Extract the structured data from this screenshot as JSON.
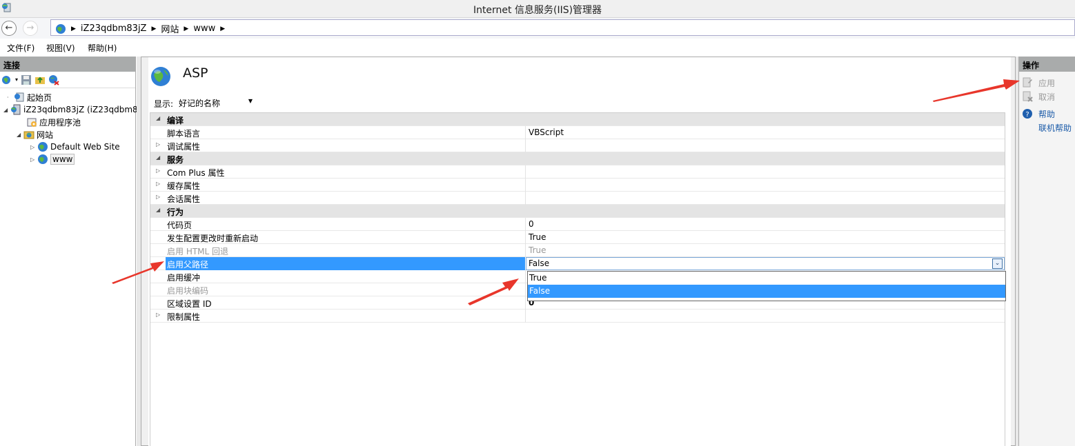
{
  "window": {
    "title": "Internet 信息服务(IIS)管理器"
  },
  "address": {
    "crumbs": [
      "iZ23qdbm83jZ",
      "网站",
      "www"
    ]
  },
  "menu": {
    "file": "文件(F)",
    "view": "视图(V)",
    "help": "帮助(H)"
  },
  "connections": {
    "header": "连接",
    "tree": [
      {
        "label": "起始页",
        "icon": "start-page-icon"
      },
      {
        "label": "iZ23qdbm83jZ (iZ23qdbm8",
        "icon": "server-icon"
      },
      {
        "label": "应用程序池",
        "icon": "app-pool-icon"
      },
      {
        "label": "网站",
        "icon": "sites-folder-icon"
      },
      {
        "label": "Default Web Site",
        "icon": "globe-icon"
      },
      {
        "label": "www",
        "icon": "globe-icon"
      }
    ]
  },
  "main": {
    "title": "ASP",
    "show_label": "显示:",
    "show_value": "好记的名称",
    "rows": [
      {
        "kind": "cat",
        "name": "编译",
        "toggle": "◢"
      },
      {
        "kind": "prop",
        "name": "脚本语言",
        "value": "VBScript"
      },
      {
        "kind": "group",
        "name": "调试属性",
        "toggle": "▷"
      },
      {
        "kind": "cat",
        "name": "服务",
        "toggle": "◢"
      },
      {
        "kind": "group",
        "name": "Com Plus 属性",
        "toggle": "▷"
      },
      {
        "kind": "group",
        "name": "缓存属性",
        "toggle": "▷"
      },
      {
        "kind": "group",
        "name": "会话属性",
        "toggle": "▷"
      },
      {
        "kind": "cat",
        "name": "行为",
        "toggle": "◢"
      },
      {
        "kind": "prop",
        "name": "代码页",
        "value": "0"
      },
      {
        "kind": "prop",
        "name": "发生配置更改时重新启动",
        "value": "True"
      },
      {
        "kind": "disabled",
        "name": "启用 HTML 回退",
        "value": "True"
      },
      {
        "kind": "selected",
        "name": "启用父路径",
        "value": "False"
      },
      {
        "kind": "prop",
        "name": "启用缓冲",
        "value": ""
      },
      {
        "kind": "disabled",
        "name": "启用块编码",
        "value": ""
      },
      {
        "kind": "prop",
        "name": "区域设置 ID",
        "value": "0"
      },
      {
        "kind": "group",
        "name": "限制属性",
        "toggle": "▷"
      }
    ],
    "dropdown_options": [
      "True",
      "False"
    ],
    "dropdown_selected": "False"
  },
  "actions": {
    "header": "操作",
    "apply": "应用",
    "cancel": "取消",
    "help": "帮助",
    "online_help": "联机帮助"
  },
  "colors": {
    "selection": "#3399ff",
    "pane_header": "#a9abab",
    "arrow": "#e8362b",
    "link": "#1a5aa8"
  }
}
